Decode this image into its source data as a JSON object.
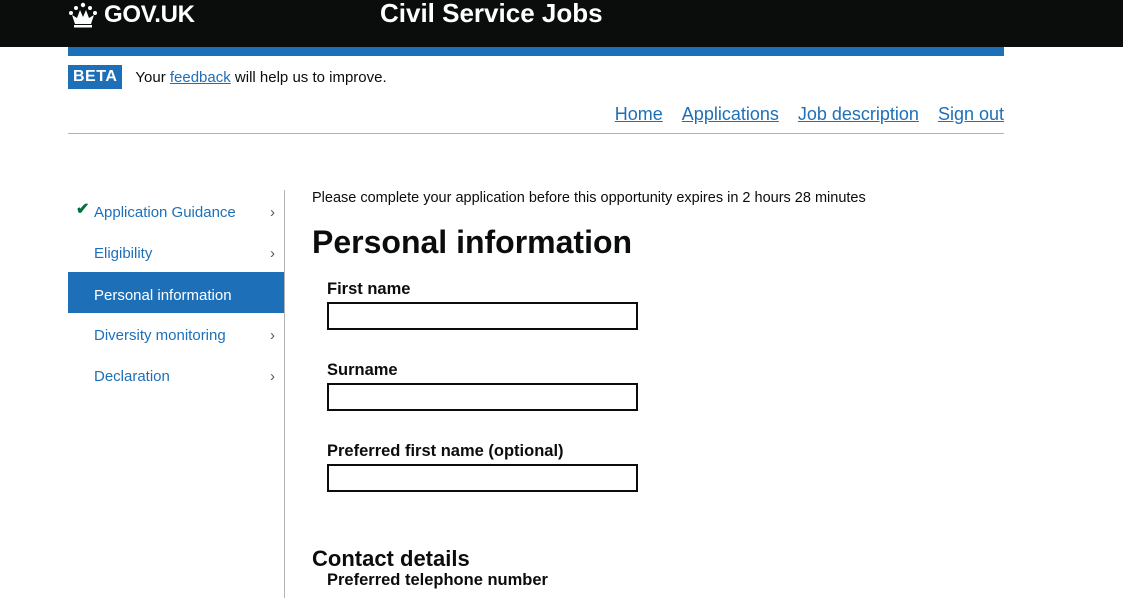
{
  "header": {
    "logo_text": "GOV.UK",
    "service_name": "Civil Service Jobs"
  },
  "beta_banner": {
    "tag": "BETA",
    "text_before": "Your",
    "link": "feedback",
    "text_after": "will help us to improve."
  },
  "topnav": {
    "home": "Home",
    "applications": "Applications",
    "job_description": "Job description",
    "sign_out": "Sign out"
  },
  "sidenav": {
    "items": [
      {
        "label": "Application Guidance",
        "completed": true
      },
      {
        "label": "Eligibility"
      },
      {
        "label": "Personal information",
        "active": true
      },
      {
        "label": "Diversity monitoring"
      },
      {
        "label": "Declaration"
      }
    ],
    "chevron": "›",
    "tick": "✔"
  },
  "main": {
    "expiry_notice": "Please complete your application before this opportunity expires in 2 hours 28 minutes",
    "title": "Personal information",
    "fields": {
      "first_name": {
        "label": "First name",
        "value": ""
      },
      "surname": {
        "label": "Surname",
        "value": ""
      },
      "preferred_first_name": {
        "label": "Preferred first name (optional)",
        "value": ""
      }
    },
    "contact_heading": "Contact details",
    "phone_label": "Preferred telephone number"
  },
  "colors": {
    "header_bg": "#0b0c0c",
    "brand_blue": "#1d70b8",
    "tick_green": "#00703c"
  }
}
